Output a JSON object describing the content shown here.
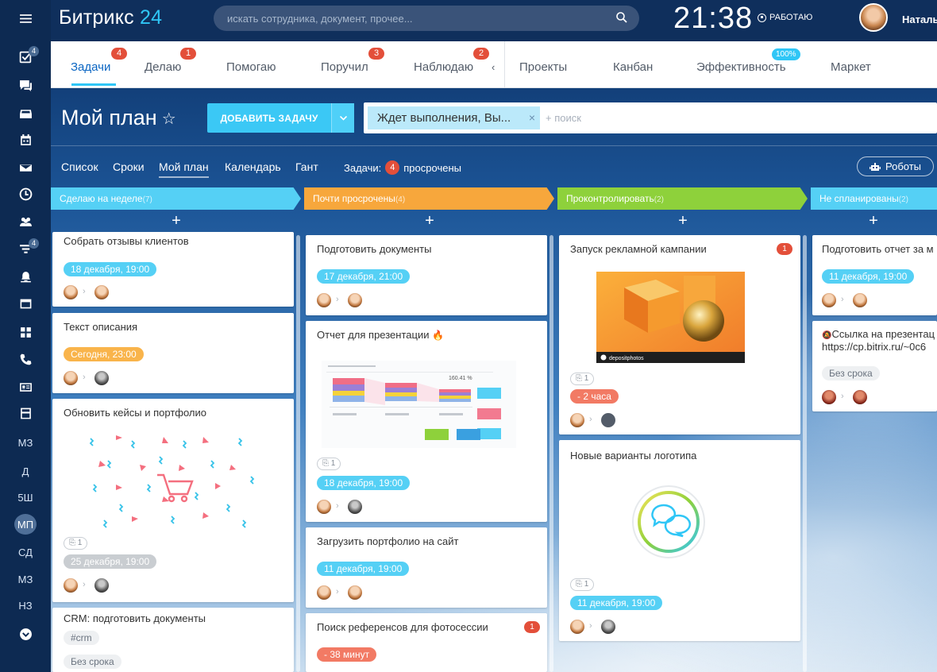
{
  "brand": {
    "name": "Битрикс",
    "num": "24"
  },
  "search": {
    "placeholder": "искать сотрудника, документ, прочее..."
  },
  "clock": "21:38",
  "work_status": "РАБОТАЮ",
  "user": {
    "name": "Натальи"
  },
  "left_nav": {
    "badges": {
      "tasks": "4",
      "filter": "4"
    },
    "letters": [
      "МЗ",
      "Д",
      "5Ш",
      "МП",
      "СД",
      "МЗ",
      "НЗ"
    ]
  },
  "tabs": [
    {
      "label": "Задачи",
      "badge": "4"
    },
    {
      "label": "Делаю",
      "badge": "1"
    },
    {
      "label": "Помогаю",
      "badge": ""
    },
    {
      "label": "Поручил",
      "badge": "3"
    },
    {
      "label": "Наблюдаю",
      "badge": "2"
    },
    {
      "label": "Проекты",
      "badge": ""
    },
    {
      "label": "Канбан",
      "badge": ""
    },
    {
      "label": "Эффективность",
      "badge": "100%"
    },
    {
      "label": "Маркет",
      "badge": ""
    }
  ],
  "page_title": "Мой план",
  "add_task": "ДОБАВИТЬ ЗАДАЧУ",
  "filter": {
    "chip": "Ждет выполнения, Вы...",
    "search": "+ поиск"
  },
  "views": [
    "Список",
    "Сроки",
    "Мой план",
    "Календарь",
    "Гант"
  ],
  "tasks_info": {
    "label": "Задачи:",
    "count": "4",
    "suffix": "просрочены"
  },
  "robots": "Роботы",
  "colors": {
    "accent": "#2fc6f6",
    "badge": "#e34f3a"
  },
  "columns": [
    {
      "title": "Сделаю на неделе",
      "count": "(7)",
      "color": "#55d0f5",
      "cards": [
        {
          "title": "Собрать отзывы клиентов",
          "deadline": "18 декабря, 19:00"
        },
        {
          "title": "Текст описания",
          "deadline": "Сегодня, 23:00"
        },
        {
          "title": "Обновить кейсы и портфолио",
          "clip": "1",
          "deadline": "25 декабря, 19:00"
        },
        {
          "title": "CRM: подготовить документы",
          "tag": "#crm",
          "deadline": "Без срока"
        }
      ]
    },
    {
      "title": "Почти просрочены",
      "count": "(4)",
      "color": "#f7a73c",
      "cards": [
        {
          "title": "Подготовить документы",
          "deadline": "17 декабря, 21:00"
        },
        {
          "title": "Отчет для презентации",
          "clip": "1",
          "deadline": "18 декабря, 19:00",
          "preview_value": "160.41 %"
        },
        {
          "title": "Загрузить портфолио на сайт",
          "deadline": "11 декабря, 19:00"
        },
        {
          "title": "Поиск референсов для фотосессии",
          "badge": "1",
          "deadline": "- 38 минут"
        }
      ]
    },
    {
      "title": "Проконтролировать",
      "count": "(2)",
      "color": "#8ed13b",
      "cards": [
        {
          "title": "Запуск рекламной кампании",
          "badge": "1",
          "clip": "1",
          "deadline": "- 2 часа",
          "image_label": "depositphotos"
        },
        {
          "title": "Новые варианты логотипа",
          "clip": "1",
          "deadline": "11 декабря, 19:00"
        }
      ]
    },
    {
      "title": "Не спланированы",
      "count": "(2)",
      "color": "#55d0f5",
      "cards": [
        {
          "title": "Подготовить отчет за м",
          "deadline": "11 декабря, 19:00"
        },
        {
          "title": "Ссылка на презентац",
          "subtitle": "https://cp.bitrix.ru/~0c6",
          "deadline": "Без срока"
        }
      ]
    }
  ]
}
